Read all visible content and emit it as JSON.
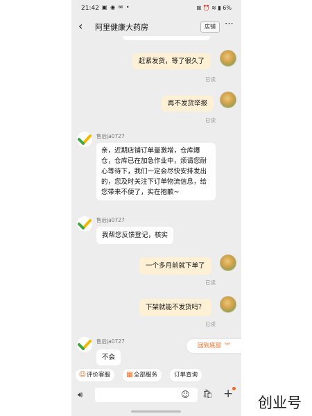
{
  "status_bar": {
    "time": "21:42",
    "left_icons": "▣ ◉ ✉ •",
    "right_icons": "⊠ ⏰ ≋ ▮ 6%"
  },
  "header": {
    "back_icon": "chevron-left",
    "title": "阿里健康大药房",
    "store_label": "店铺",
    "more_icon": "ellipsis"
  },
  "messages": [
    {
      "side": "right",
      "text": "赶紧发货，等了很久了",
      "status": "已读"
    },
    {
      "side": "right",
      "text": "再不发货举报",
      "status": "已读"
    },
    {
      "side": "left",
      "sender": "售后ja0727",
      "text": "亲，近期店铺订单量激增，仓库爆仓，仓库已在加急作业中，烦请您耐心等待下，我们一定会尽快安排发出的，您及时关注下订单物流信息，给您带来不便了，实在抱歉~"
    },
    {
      "side": "left",
      "sender": "售后ja0727",
      "text": "我帮您反馈登记，核实"
    },
    {
      "side": "right",
      "text": "一个多月前就下单了",
      "status": "已读"
    },
    {
      "side": "right",
      "text": "下架就能不发货吗？",
      "status": "已读"
    },
    {
      "side": "left",
      "sender": "售后ja0727",
      "text": "不会"
    }
  ],
  "scroll_bottom_label": "回到底部",
  "quick_actions": [
    {
      "icon": "smile-icon",
      "label": "评价客服"
    },
    {
      "icon": "grid-icon",
      "label": "全部服务"
    },
    {
      "icon": "",
      "label": "订单查询"
    }
  ],
  "watermark": "创业号",
  "colors": {
    "right_bubble": "#fdf0d4",
    "left_bubble": "#ffffff",
    "accent": "#f26b1d",
    "background": "#ededed"
  }
}
